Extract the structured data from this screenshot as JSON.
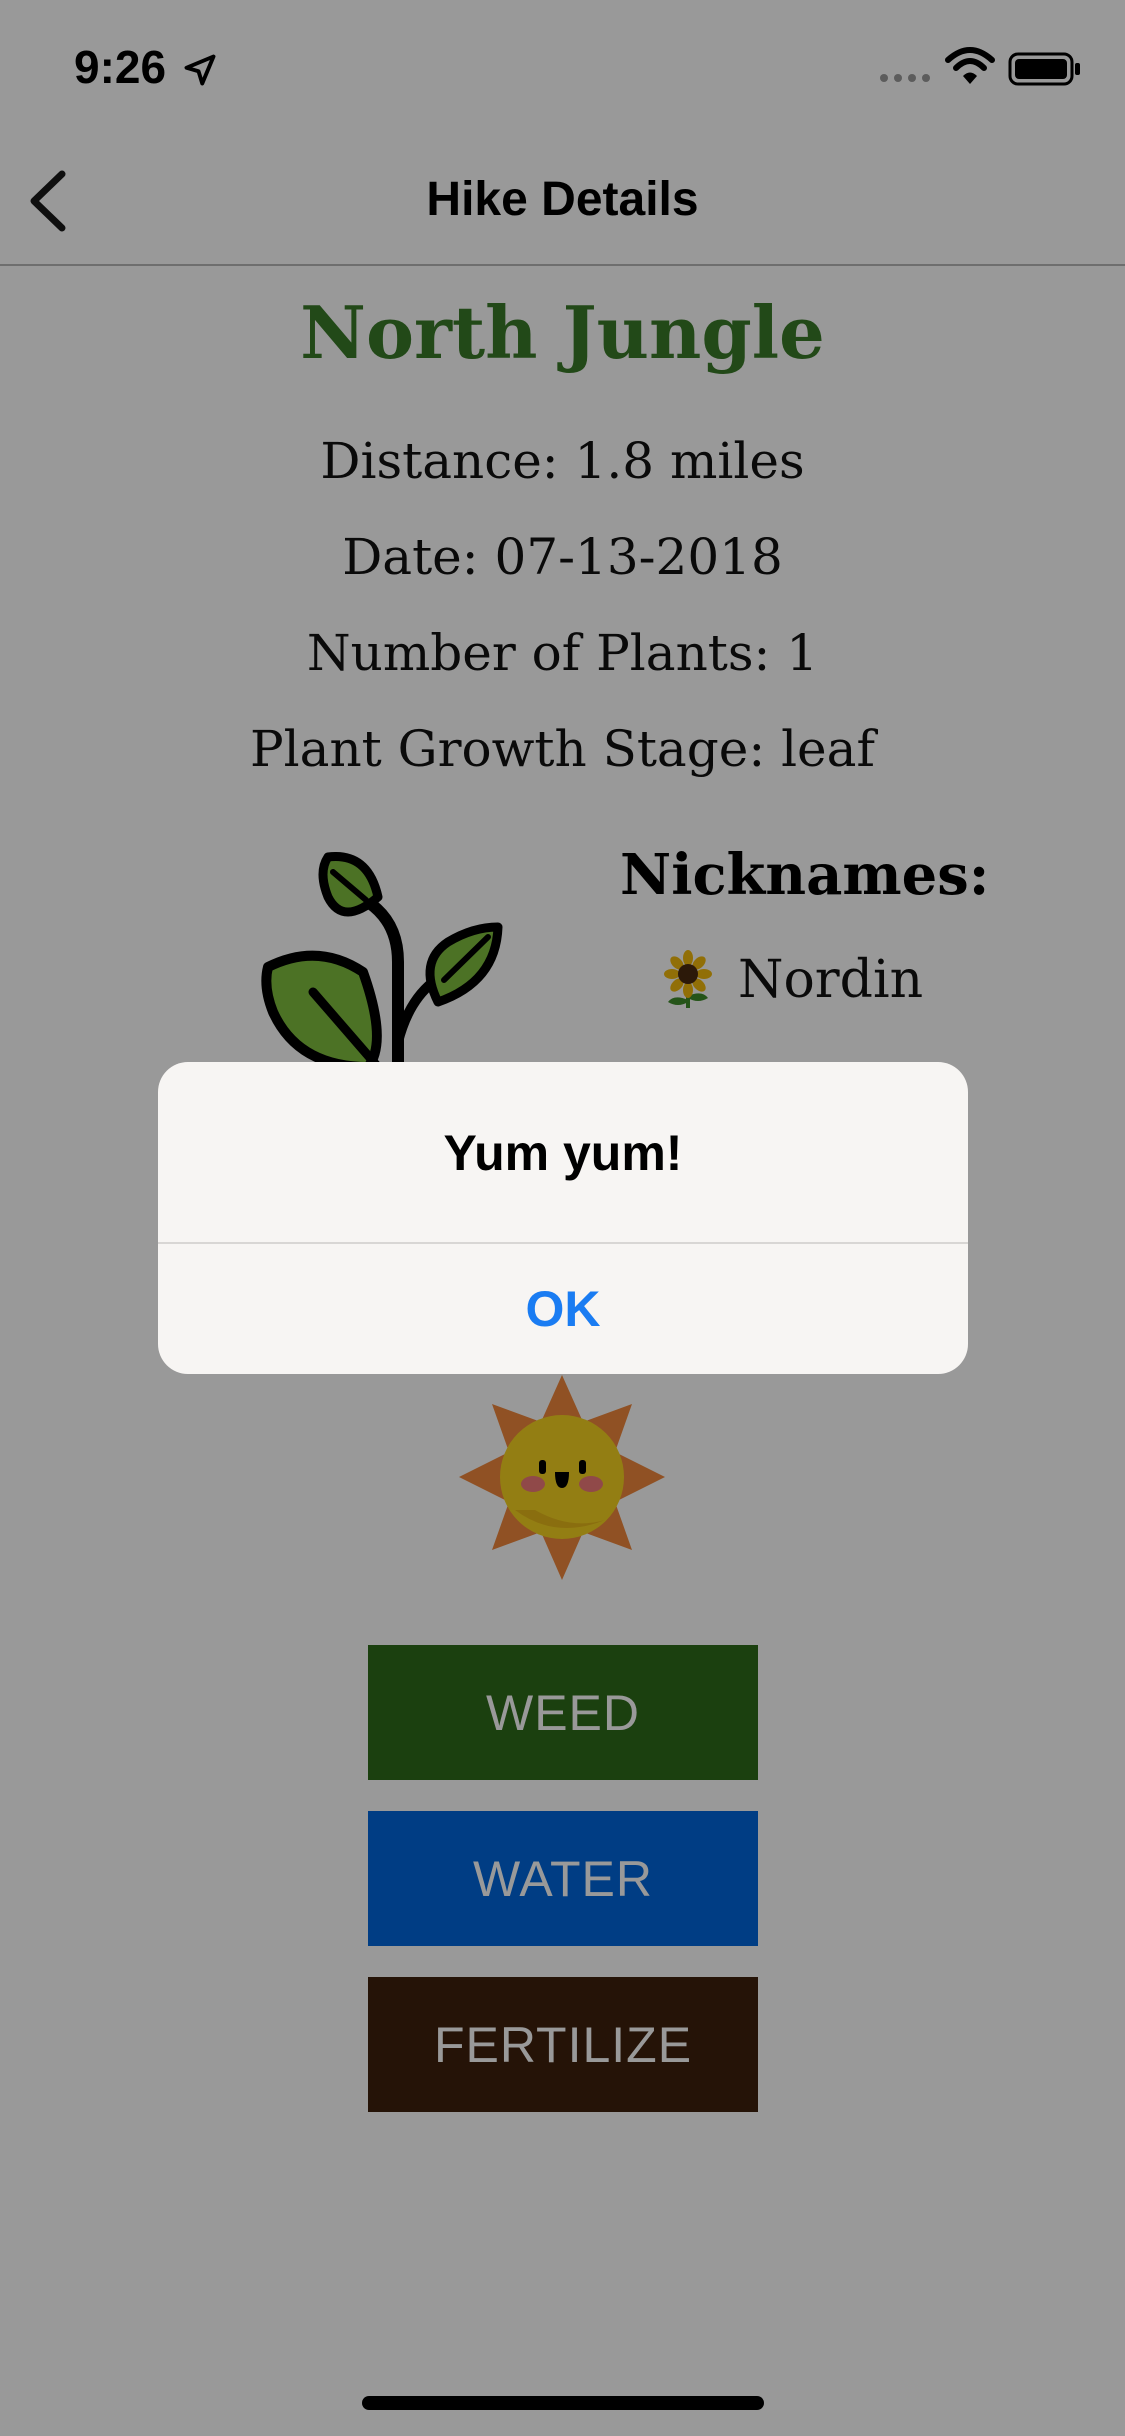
{
  "status_bar": {
    "time": "9:26"
  },
  "nav": {
    "title": "Hike Details"
  },
  "hike": {
    "name": "North Jungle",
    "distance": "Distance: 1.8 miles",
    "date": "Date: 07-13-2018",
    "plants": "Number of Plants: 1",
    "stage": "Plant Growth Stage: leaf"
  },
  "nicknames": {
    "title": "Nicknames:",
    "items": [
      {
        "icon": "sunflower-icon",
        "name": "Nordin"
      }
    ]
  },
  "actions": {
    "weed": "WEED",
    "water": "WATER",
    "fertilize": "FERTILIZE"
  },
  "alert": {
    "title": "Yum yum!",
    "ok": "OK"
  },
  "colors": {
    "hike_name": "#3a7a28",
    "weed": "#2e6b1a",
    "water": "#0066dd",
    "fertilize": "#3f210c",
    "alert_button": "#1a7cf2"
  }
}
